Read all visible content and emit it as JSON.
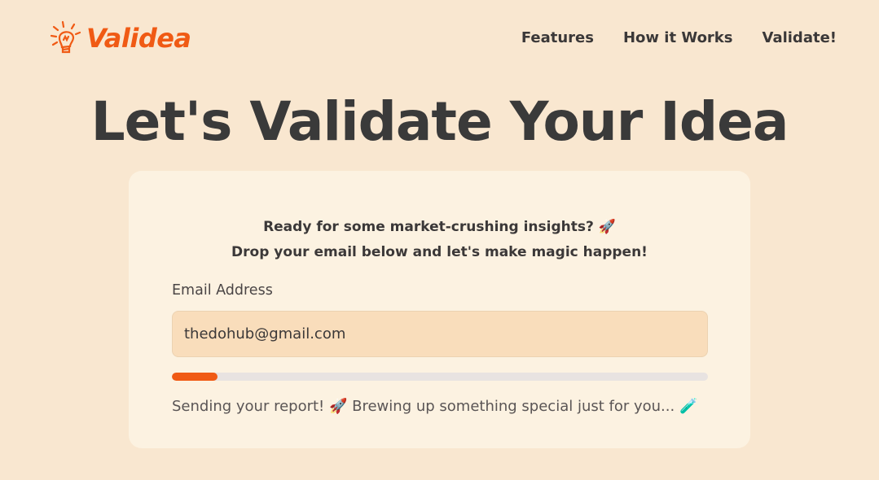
{
  "brand": {
    "name": "Validea",
    "color": "#f05a14",
    "icon": "lightbulb-icon"
  },
  "nav": {
    "items": [
      {
        "label": "Features"
      },
      {
        "label": "How it Works"
      },
      {
        "label": "Validate!"
      }
    ]
  },
  "hero": {
    "title": "Let's Validate Your Idea"
  },
  "card": {
    "intro_line1": "Ready for some market-crushing insights? 🚀",
    "intro_line2": "Drop your email below and let's make magic happen!",
    "email_label": "Email Address",
    "email_value": "thedohub@gmail.com",
    "progress_fraction": 0.085,
    "status": "Sending your report! 🚀 Brewing up something special just for you... 🧪"
  },
  "colors": {
    "background": "#f9e7d0",
    "card": "#fcf2e1",
    "accent": "#f05a14",
    "input_bg": "#f9ddbb"
  }
}
